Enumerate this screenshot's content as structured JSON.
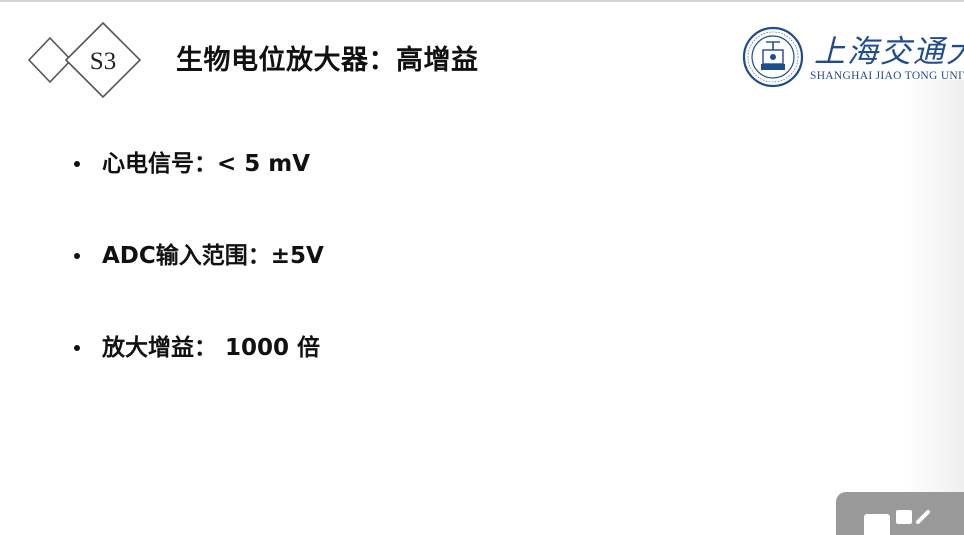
{
  "slide": {
    "section_label": "S3",
    "title": "生物电位放大器：高增益"
  },
  "logo": {
    "name_cn": "上海交通大学",
    "name_en": "SHANGHAI JIAO TONG UNIVERSITY",
    "color": "#1f4b8f",
    "icon": "university-emblem-icon"
  },
  "bullets": [
    {
      "text": "心电信号：< 5 mV"
    },
    {
      "text": "ADC输入范围：±5V"
    },
    {
      "text": "放大增益： 1000 倍"
    }
  ],
  "widget": {
    "icon": "screen-share-icon"
  }
}
